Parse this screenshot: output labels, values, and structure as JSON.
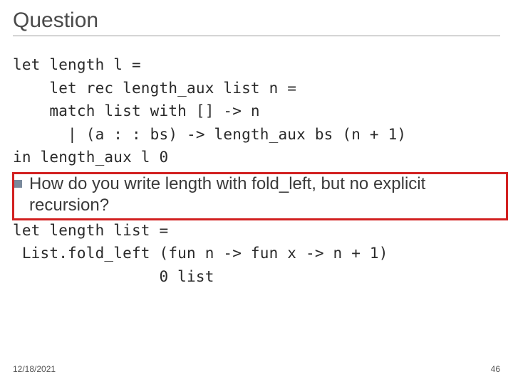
{
  "title": "Question",
  "code_block_1": "let length l =\n    let rec length_aux list n =\n    match list with [] -> n\n      | (a : : bs) -> length_aux bs (n + 1)\nin length_aux l 0",
  "question_text": "How do you write length with fold_left, but no explicit recursion?",
  "code_block_2": "let length list =\n List.fold_left (fun n -> fun x -> n + 1)\n                0 list",
  "footer": {
    "date": "12/18/2021",
    "page_number": "46"
  }
}
